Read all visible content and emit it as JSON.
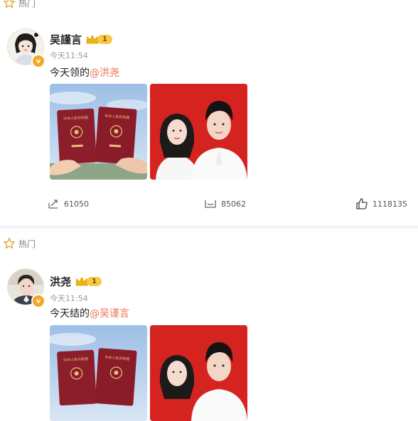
{
  "top_tag": {
    "label": "热门",
    "icon": "star-icon"
  },
  "posts": [
    {
      "tag": "",
      "author": "吴謹言",
      "vip_level": "1",
      "time": "今天11:54",
      "text_prefix": "今天领的",
      "mention": "@洪尧",
      "images": [
        "passports-photo",
        "couple-red-photo"
      ],
      "repost_count": "61050",
      "comment_count": "85062",
      "like_count": "1118135"
    },
    {
      "tag": "热门",
      "author": "洪尧",
      "vip_level": "1",
      "time": "今天11:54",
      "text_prefix": "今天结的",
      "mention": "@吴谨言",
      "images": [
        "passports-photo",
        "couple-red-photo"
      ]
    }
  ],
  "colors": {
    "mention": "#eb7350",
    "badge": "#f5a623",
    "vip": "#f7c944",
    "photo_red": "#d5231f",
    "passport_red": "#8c1d2a",
    "sky_blue": "#9dbfe6"
  }
}
